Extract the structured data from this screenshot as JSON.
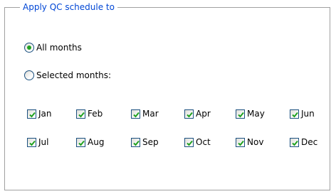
{
  "group": {
    "legend": "Apply QC schedule to"
  },
  "options": {
    "all_months": {
      "label": "All months",
      "selected": true
    },
    "selected_months": {
      "label": "Selected months:",
      "selected": false
    }
  },
  "months_row1": [
    {
      "label": "Jan",
      "checked": true
    },
    {
      "label": "Feb",
      "checked": true
    },
    {
      "label": "Mar",
      "checked": true
    },
    {
      "label": "Apr",
      "checked": true
    },
    {
      "label": "May",
      "checked": true
    },
    {
      "label": "Jun",
      "checked": true
    }
  ],
  "months_row2": [
    {
      "label": "Jul",
      "checked": true
    },
    {
      "label": "Aug",
      "checked": true
    },
    {
      "label": "Sep",
      "checked": true
    },
    {
      "label": "Oct",
      "checked": true
    },
    {
      "label": "Nov",
      "checked": true
    },
    {
      "label": "Dec",
      "checked": true
    }
  ],
  "colors": {
    "legend_text": "#0046d5",
    "check_mark": "#21a121",
    "control_border": "#1c5180",
    "group_border": "#a0a0a0"
  }
}
